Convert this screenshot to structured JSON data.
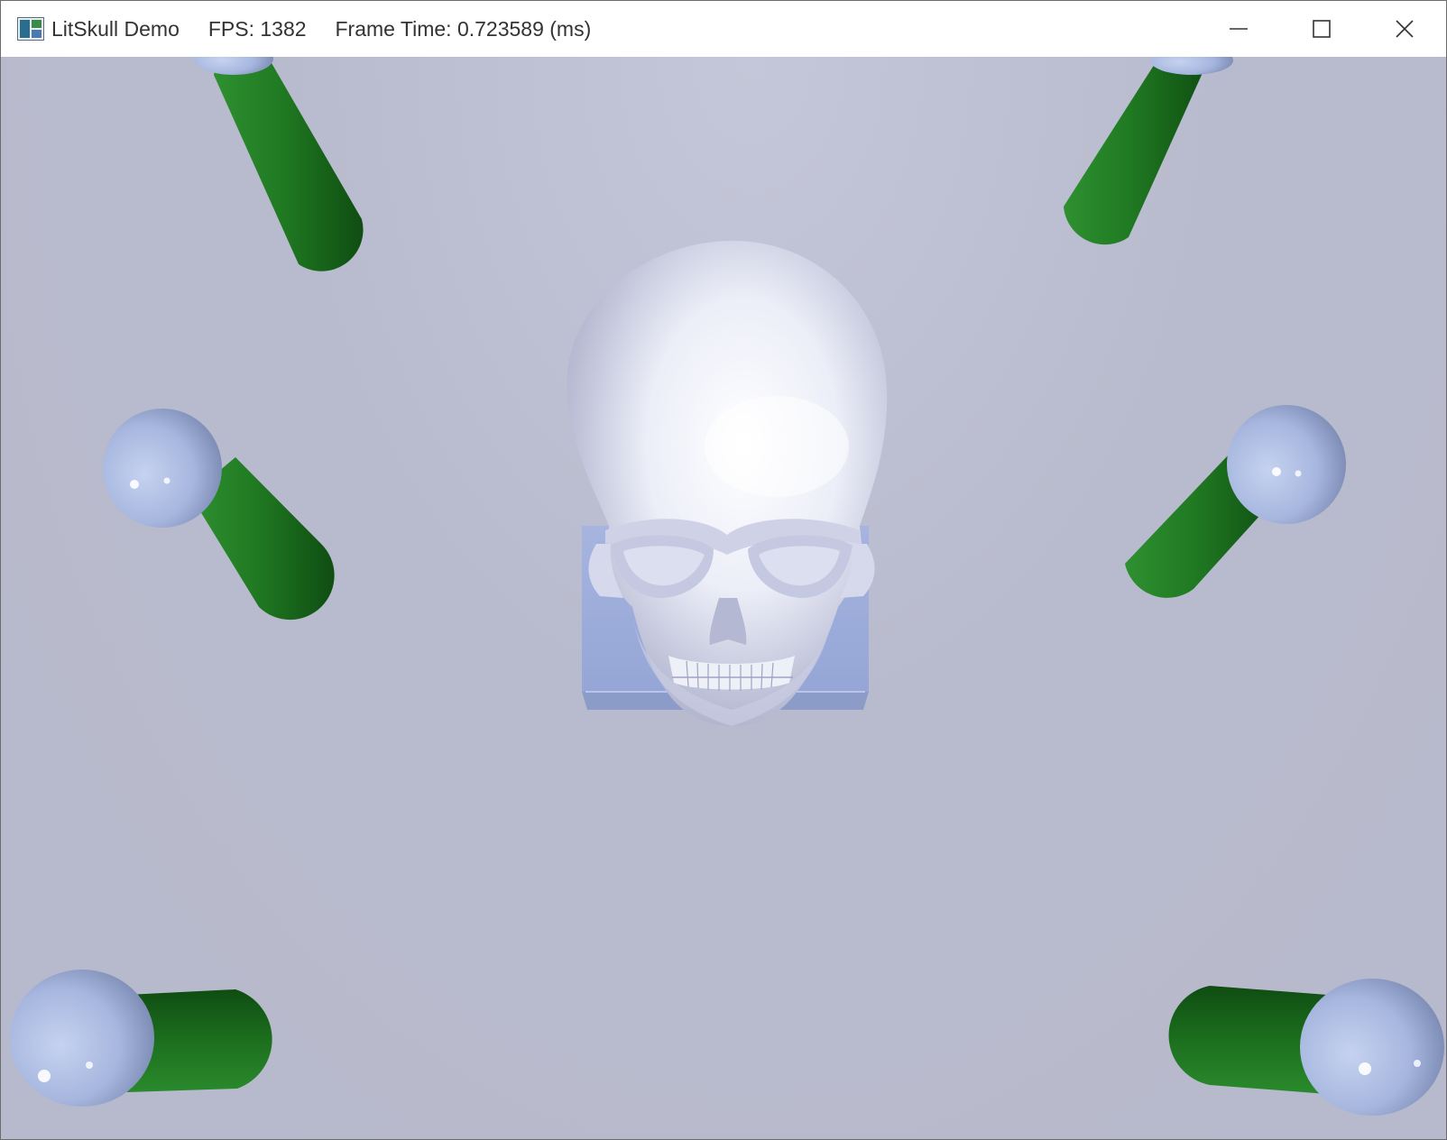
{
  "window": {
    "app_name": "LitSkull Demo",
    "fps_text": "FPS: 1382",
    "frame_time_text": "Frame Time: 0.723589 (ms)",
    "controls": {
      "minimize_icon": "minimize-icon",
      "maximize_icon": "maximize-icon",
      "close_icon": "close-icon"
    }
  },
  "scene": {
    "background_color": "#b7b9cc",
    "skull_color": "#e6e8f4",
    "box_color": "#9aaad6",
    "pillar_color": "#1f7a1f",
    "sphere_color": "#a8b8e0"
  }
}
